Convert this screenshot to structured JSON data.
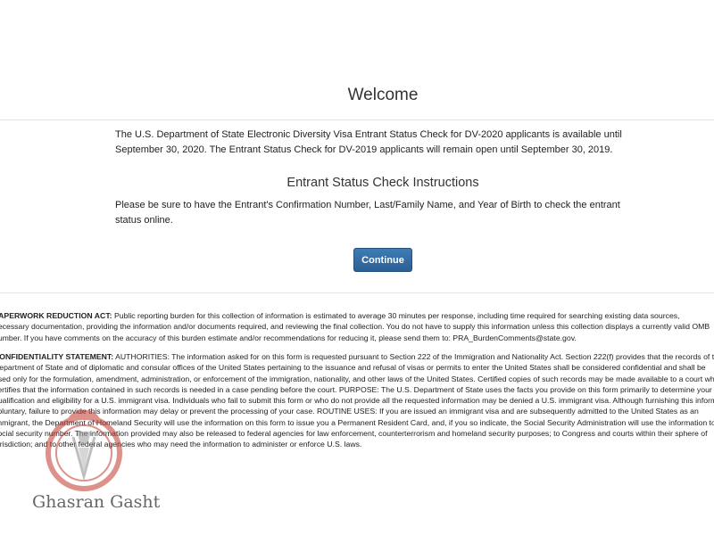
{
  "welcome": {
    "title": "Welcome"
  },
  "notice": {
    "text": "The U.S. Department of State Electronic Diversity Visa Entrant Status Check for DV-2020 applicants is available until September 30, 2020. The Entrant Status Check for DV-2019 applicants will remain open until September 30, 2019."
  },
  "instructions": {
    "title": "Entrant Status Check Instructions",
    "text": "Please be sure to have the Entrant's Confirmation Number, Last/Family Name, and Year of Birth to check the entrant status online."
  },
  "continue_button": {
    "label": "Continue"
  },
  "paperwork": {
    "heading": "PAPERWORK REDUCTION ACT:",
    "lines": [
      " Public reporting burden for this collection of information is estimated to average 30 minutes per response, including time required for searching existing data sources,",
      "necessary documentation, providing the information and/or documents required, and reviewing the final collection. You do not have to supply this information unless this collection displays a currently valid OMB",
      "number. If you have comments on the accuracy of this burden estimate and/or recommendations for reducing it, please send them to: PRA_BurdenComments@state.gov."
    ]
  },
  "confidentiality": {
    "heading": "CONFIDENTIALITY STATEMENT:",
    "lines": [
      " AUTHORITIES: The information asked for on this form is requested pursuant to Section 222 of the Immigration and Nationality Act. Section 222(f) provides that the records of the",
      "Department of State and of diplomatic and consular offices of the United States pertaining to the issuance and refusal of visas or permits to enter the United States shall be considered confidential and shall be",
      "used only for the formulation, amendment, administration, or enforcement of the immigration, nationality, and other laws of the United States. Certified copies of such records may be made available to a court which",
      "certifies that the information contained in such records is needed in a case pending before the court. PURPOSE: The U.S. Department of State uses the facts you provide on this form primarily to determine your",
      "qualification and eligibility for a U.S. immigrant visa. Individuals who fail to submit this form or who do not provide all the requested information may be denied a U.S. immigrant visa. Although furnishing this information is",
      "voluntary, failure to provide this information may delay or prevent the processing of your case. ROUTINE USES: If you are issued an immigrant visa and are subsequently admitted to the United States as an",
      "immigrant, the Department of Homeland Security will use the information on this form to issue you a Permanent Resident Card, and, if you so indicate, the Social Security Administration will use the information to issue a",
      "social security number. The information provided may also be released to federal agencies for law enforcement, counterterrorism and homeland security purposes; to Congress and courts within their sphere of",
      "jurisdiction; and to other federal agencies who may need the information to administer or enforce U.S. laws."
    ]
  },
  "watermark": {
    "text": "Ghasran Gasht",
    "logo_color": "#c0392b",
    "logo_icon": "stamp-logo-icon"
  },
  "colors": {
    "button_primary": "#2f6ba3",
    "divider": "#e4e4e4"
  }
}
